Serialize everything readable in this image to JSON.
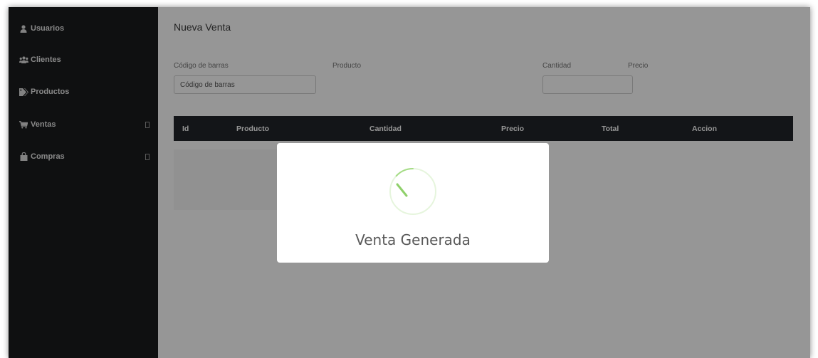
{
  "sidebar": {
    "items": [
      {
        "label": "Usuarios",
        "icon": "user-icon",
        "has_submenu": false
      },
      {
        "label": "Clientes",
        "icon": "users-icon",
        "has_submenu": false
      },
      {
        "label": "Productos",
        "icon": "tags-icon",
        "has_submenu": false
      },
      {
        "label": "Ventas",
        "icon": "cart-icon",
        "has_submenu": true
      },
      {
        "label": "Compras",
        "icon": "bag-icon",
        "has_submenu": true
      }
    ]
  },
  "main": {
    "title": "Nueva Venta",
    "form": {
      "barcode_label": "Código de barras",
      "barcode_placeholder": "Código de barras",
      "product_label": "Producto",
      "quantity_label": "Cantidad",
      "price_label": "Precio"
    },
    "table": {
      "columns": [
        "Id",
        "Producto",
        "Cantidad",
        "Precio",
        "Total",
        "Accion"
      ]
    }
  },
  "modal": {
    "title": "Venta Generada",
    "icon": "success-spinner-icon"
  },
  "colors": {
    "sidebar": "#1a1c1e",
    "table_header": "#212529",
    "success": "#a5dc86"
  }
}
